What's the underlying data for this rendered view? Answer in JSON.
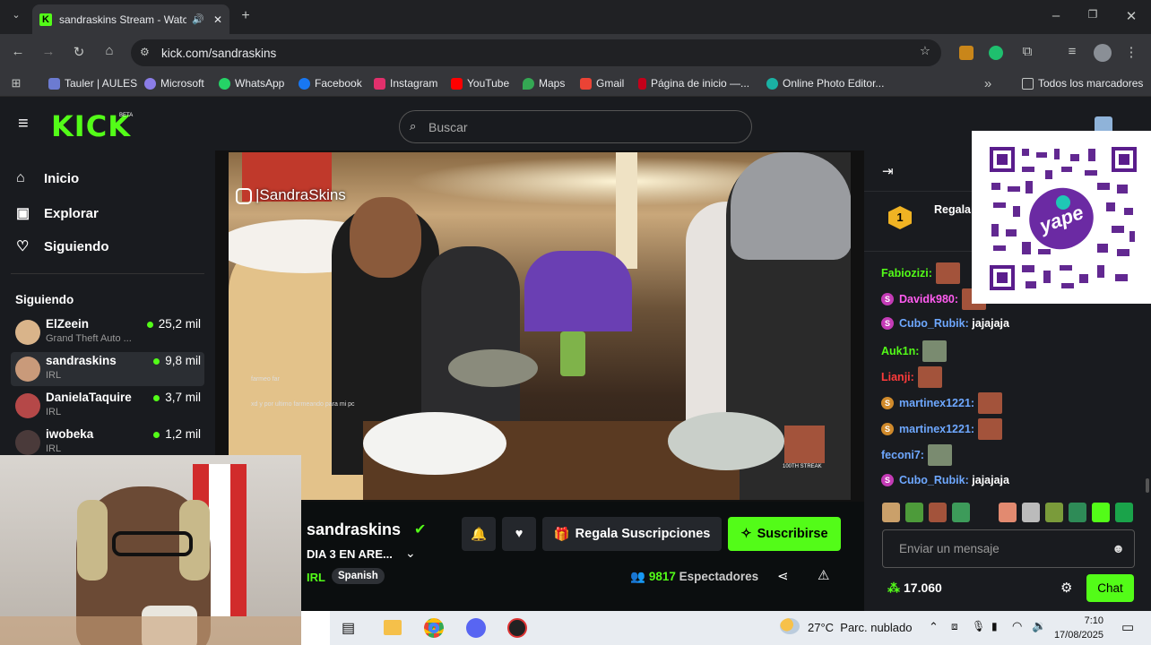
{
  "browser": {
    "tab_title": "sandraskins Stream - Watch",
    "url": "kick.com/sandraskins",
    "bookmarks": [
      "Tauler | AULES",
      "Microsoft",
      "WhatsApp",
      "Facebook",
      "Instagram",
      "YouTube",
      "Maps",
      "Gmail",
      "Página de inicio —...",
      "Online Photo Editor..."
    ],
    "all_bookmarks": "Todos los marcadores"
  },
  "kick": {
    "logo": "KICK",
    "beta": "BETA",
    "search_placeholder": "Buscar",
    "nav": [
      "Inicio",
      "Explorar",
      "Siguiendo"
    ],
    "following_title": "Siguiendo",
    "following": [
      {
        "name": "ElZeein",
        "sub": "Grand Theft Auto ...",
        "viewers": "25,2 mil"
      },
      {
        "name": "sandraskins",
        "sub": "IRL",
        "viewers": "9,8 mil"
      },
      {
        "name": "DanielaTaquire",
        "sub": "IRL",
        "viewers": "3,7 mil"
      },
      {
        "name": "iwobeka",
        "sub": "IRL",
        "viewers": "1,2 mil"
      }
    ]
  },
  "stream": {
    "watermark": "|SandraSkins",
    "streamer": "sandraskins",
    "title": "DIA 3 EN ARE...",
    "category": "IRL",
    "tag": "Spanish",
    "gift_label": "Regala Suscripciones",
    "subscribe_label": "Suscribirse",
    "viewers": "9817",
    "viewers_label": "Espectadores",
    "overlay_chat": [
      "farmeo far",
      "xd y por ultimo farmeando para mi pc"
    ],
    "overlay_badge": "100TH STREAK"
  },
  "chat": {
    "gift_rank": "1",
    "gift_text": "Regala",
    "messages": [
      {
        "user": "Fabiozizi:",
        "text": "",
        "color": "#53fc18"
      },
      {
        "user": "Davidk980:",
        "text": "",
        "color": "#ff5cf0"
      },
      {
        "user": "Cubo_Rubik:",
        "text": "jajajaja",
        "color": "#6ea8ff"
      },
      {
        "user": "Auk1n:",
        "text": "",
        "color": "#53fc18"
      },
      {
        "user": "Lianji:",
        "text": "",
        "color": "#ff3b3b"
      },
      {
        "user": "martinex1221:",
        "text": "",
        "color": "#6ea8ff"
      },
      {
        "user": "martinex1221:",
        "text": "",
        "color": "#6ea8ff"
      },
      {
        "user": "feconi7:",
        "text": "",
        "color": "#6ea8ff"
      },
      {
        "user": "Cubo_Rubik:",
        "text": "jajajaja",
        "color": "#6ea8ff"
      }
    ],
    "input_placeholder": "Enviar un mensaje",
    "points": "17.060",
    "chat_button": "Chat"
  },
  "taskbar": {
    "weather": "27°C  Parc. nublado",
    "time": "7:10",
    "date": "17/08/2025"
  }
}
